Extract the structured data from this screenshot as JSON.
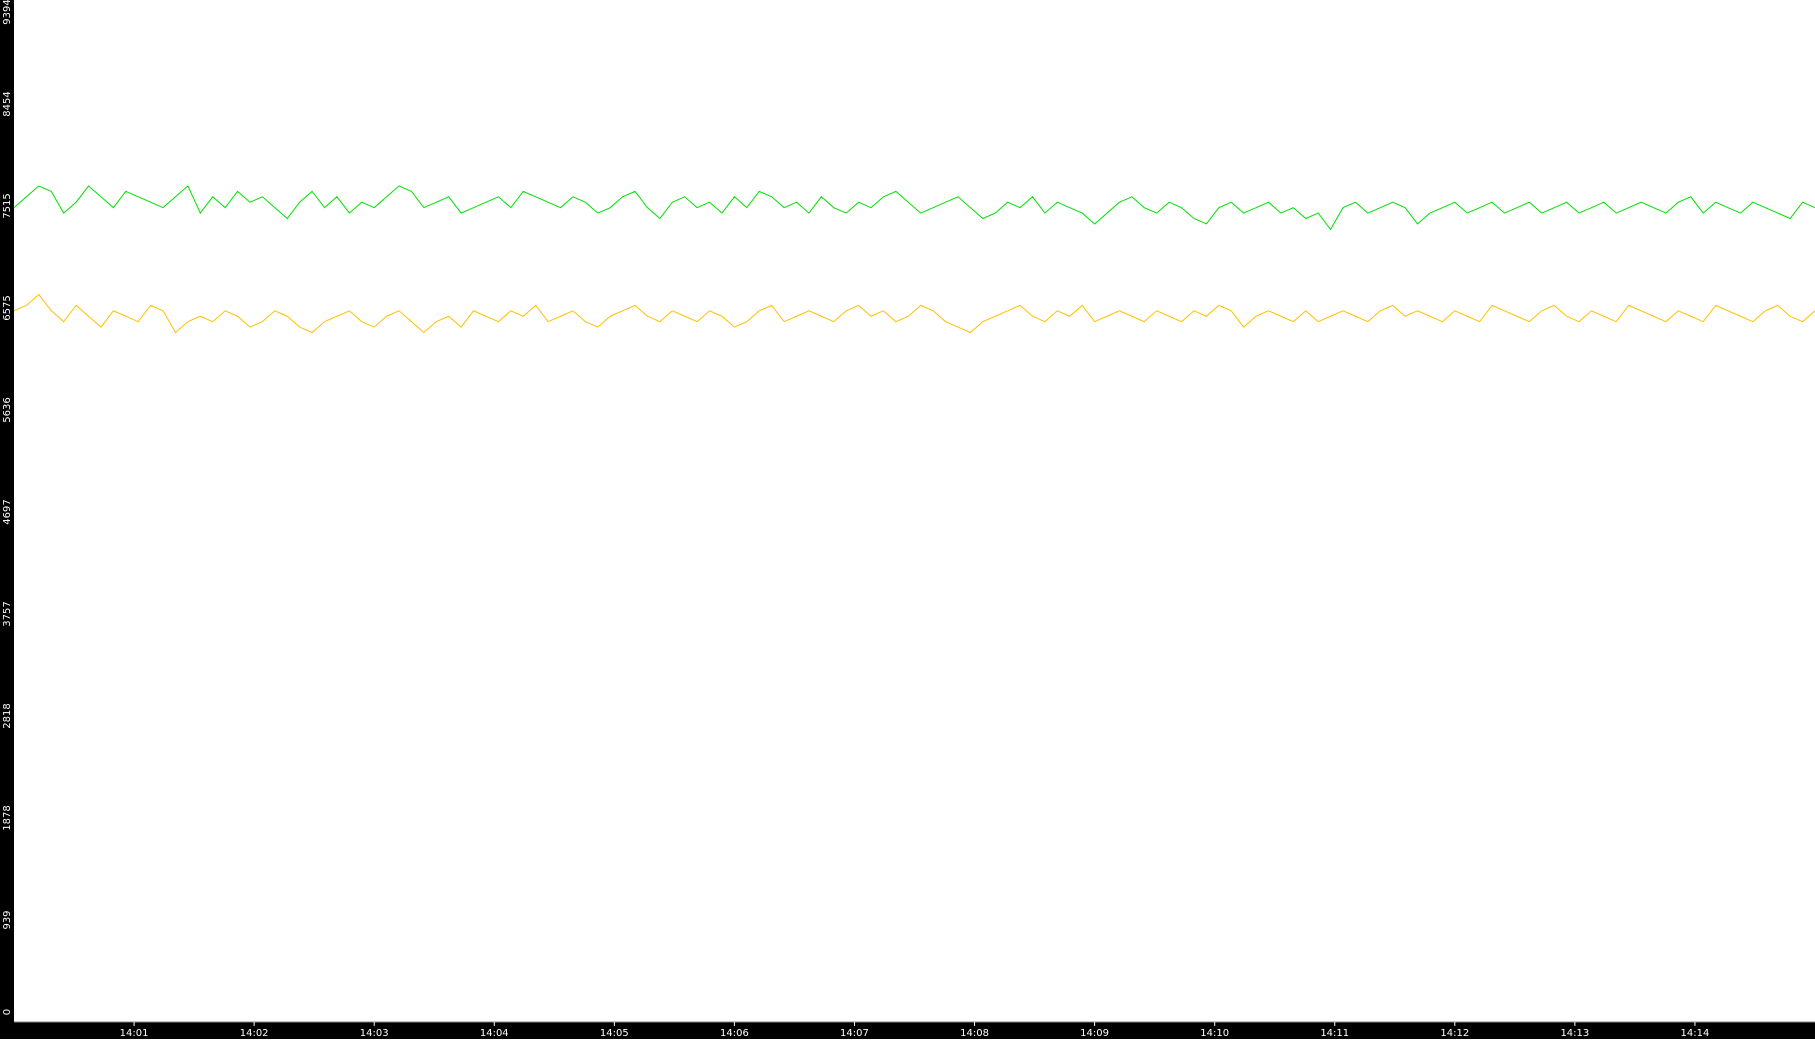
{
  "chart_data": {
    "type": "line",
    "title": "",
    "xlabel": "",
    "ylabel": "",
    "x_tick_labels": [
      "14:01",
      "14:02",
      "14:03",
      "14:04",
      "14:05",
      "14:06",
      "14:07",
      "14:08",
      "14:09",
      "14:10",
      "14:11",
      "14:12",
      "14:13",
      "14:14"
    ],
    "y_tick_labels": [
      "0",
      "939",
      "1878",
      "2818",
      "3757",
      "4697",
      "5636",
      "6575",
      "7515",
      "8454",
      "9394"
    ],
    "ylim": [
      0,
      9394
    ],
    "x_range_minutes": [
      0.0,
      15.0
    ],
    "grid": false,
    "legend": "none",
    "series": [
      {
        "color": "#00e000",
        "values": [
          7500,
          7600,
          7700,
          7650,
          7450,
          7550,
          7700,
          7600,
          7500,
          7650,
          7600,
          7550,
          7500,
          7600,
          7700,
          7450,
          7600,
          7500,
          7650,
          7550,
          7600,
          7500,
          7400,
          7550,
          7650,
          7500,
          7600,
          7450,
          7550,
          7500,
          7600,
          7700,
          7650,
          7500,
          7550,
          7600,
          7450,
          7500,
          7550,
          7600,
          7500,
          7650,
          7600,
          7550,
          7500,
          7600,
          7550,
          7450,
          7500,
          7600,
          7650,
          7500,
          7400,
          7550,
          7600,
          7500,
          7550,
          7450,
          7600,
          7500,
          7650,
          7600,
          7500,
          7550,
          7450,
          7600,
          7500,
          7450,
          7550,
          7500,
          7600,
          7650,
          7550,
          7450,
          7500,
          7550,
          7600,
          7500,
          7400,
          7450,
          7550,
          7500,
          7600,
          7450,
          7550,
          7500,
          7450,
          7350,
          7450,
          7550,
          7600,
          7500,
          7450,
          7550,
          7500,
          7400,
          7350,
          7500,
          7550,
          7450,
          7500,
          7550,
          7450,
          7500,
          7400,
          7450,
          7300,
          7500,
          7550,
          7450,
          7500,
          7550,
          7500,
          7350,
          7450,
          7500,
          7550,
          7450,
          7500,
          7550,
          7450,
          7500,
          7550,
          7450,
          7500,
          7550,
          7450,
          7500,
          7550,
          7450,
          7500,
          7550,
          7500,
          7450,
          7550,
          7600,
          7450,
          7550,
          7500,
          7450,
          7550,
          7500,
          7450,
          7400,
          7550,
          7500
        ]
      },
      {
        "color": "#ffc000",
        "values": [
          6550,
          6600,
          6700,
          6550,
          6450,
          6600,
          6500,
          6400,
          6550,
          6500,
          6450,
          6600,
          6550,
          6350,
          6450,
          6500,
          6450,
          6550,
          6500,
          6400,
          6450,
          6550,
          6500,
          6400,
          6350,
          6450,
          6500,
          6550,
          6450,
          6400,
          6500,
          6550,
          6450,
          6350,
          6450,
          6500,
          6400,
          6550,
          6500,
          6450,
          6550,
          6500,
          6600,
          6450,
          6500,
          6550,
          6450,
          6400,
          6500,
          6550,
          6600,
          6500,
          6450,
          6550,
          6500,
          6450,
          6550,
          6500,
          6400,
          6450,
          6550,
          6600,
          6450,
          6500,
          6550,
          6500,
          6450,
          6550,
          6600,
          6500,
          6550,
          6450,
          6500,
          6600,
          6550,
          6450,
          6400,
          6350,
          6450,
          6500,
          6550,
          6600,
          6500,
          6450,
          6550,
          6500,
          6600,
          6450,
          6500,
          6550,
          6500,
          6450,
          6550,
          6500,
          6450,
          6550,
          6500,
          6600,
          6550,
          6400,
          6500,
          6550,
          6500,
          6450,
          6550,
          6450,
          6500,
          6550,
          6500,
          6450,
          6550,
          6600,
          6500,
          6550,
          6500,
          6450,
          6550,
          6500,
          6450,
          6600,
          6550,
          6500,
          6450,
          6550,
          6600,
          6500,
          6450,
          6550,
          6500,
          6450,
          6600,
          6550,
          6500,
          6450,
          6550,
          6500,
          6450,
          6600,
          6550,
          6500,
          6450,
          6550,
          6600,
          6500,
          6450,
          6550
        ]
      }
    ]
  }
}
